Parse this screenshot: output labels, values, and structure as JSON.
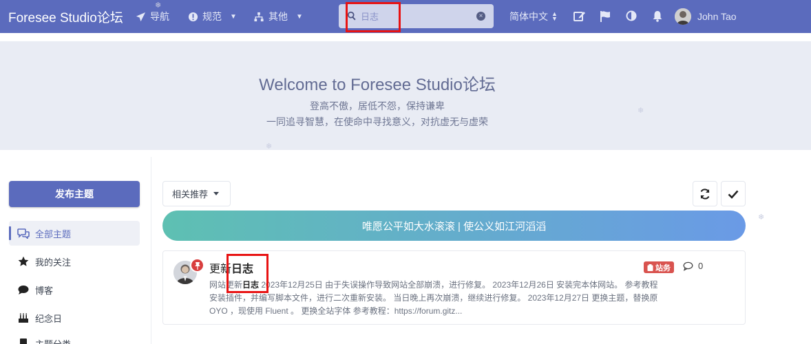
{
  "header": {
    "brand": "Foresee Studio论坛",
    "nav": [
      {
        "label": "导航",
        "icon": "paper-plane-icon"
      },
      {
        "label": "规范",
        "icon": "exclamation-circle-icon"
      },
      {
        "label": "其他",
        "icon": "sitemap-icon"
      }
    ],
    "search": {
      "placeholder": "日志",
      "value": ""
    },
    "language": "简体中文",
    "user_name": "John Tao"
  },
  "hero": {
    "title": "Welcome to Foresee Studio论坛",
    "line1": "登高不傲，居低不怨，保持谦卑",
    "line2": "一同追寻智慧，在使命中寻找意义，对抗虚无与虚荣"
  },
  "sidebar": {
    "post_button": "发布主题",
    "items": [
      {
        "label": "全部主题",
        "icon": "comments-icon",
        "active": true
      },
      {
        "label": "我的关注",
        "icon": "star-icon"
      },
      {
        "label": "博客",
        "icon": "comment-icon"
      },
      {
        "label": "纪念日",
        "icon": "birthday-cake-icon"
      },
      {
        "label": "主题分类",
        "icon": "book-icon"
      }
    ]
  },
  "toolbar": {
    "sort_label": "相关推荐"
  },
  "banner": {
    "text": "唯愿公平如大水滚滚 | 使公义如江河滔滔"
  },
  "discussions": [
    {
      "title_prefix": "更新",
      "title_highlight": "日志",
      "tag": "站务",
      "reply_count": "0",
      "excerpt_pre": "网站更新",
      "excerpt_highlight": "日志",
      "excerpt_post": " 2023年12月25日 由于失误操作导致网站全部崩溃，进行修复。 2023年12月26日 安装完本体网站。 参考教程 安装插件，并编写脚本文件，进行二次重新安装。 当日晚上再次崩溃，继续进行修复。 2023年12月27日 更换主题，替换原 OYO ，现使用 Fluent 。 更换全站字体 参考教程：https://forum.gitz..."
    }
  ],
  "colors": {
    "header": "#5b6bbd",
    "hero_bg": "#e9ecf4",
    "highlight_box": "#e81212",
    "tag": "#d9534f"
  }
}
